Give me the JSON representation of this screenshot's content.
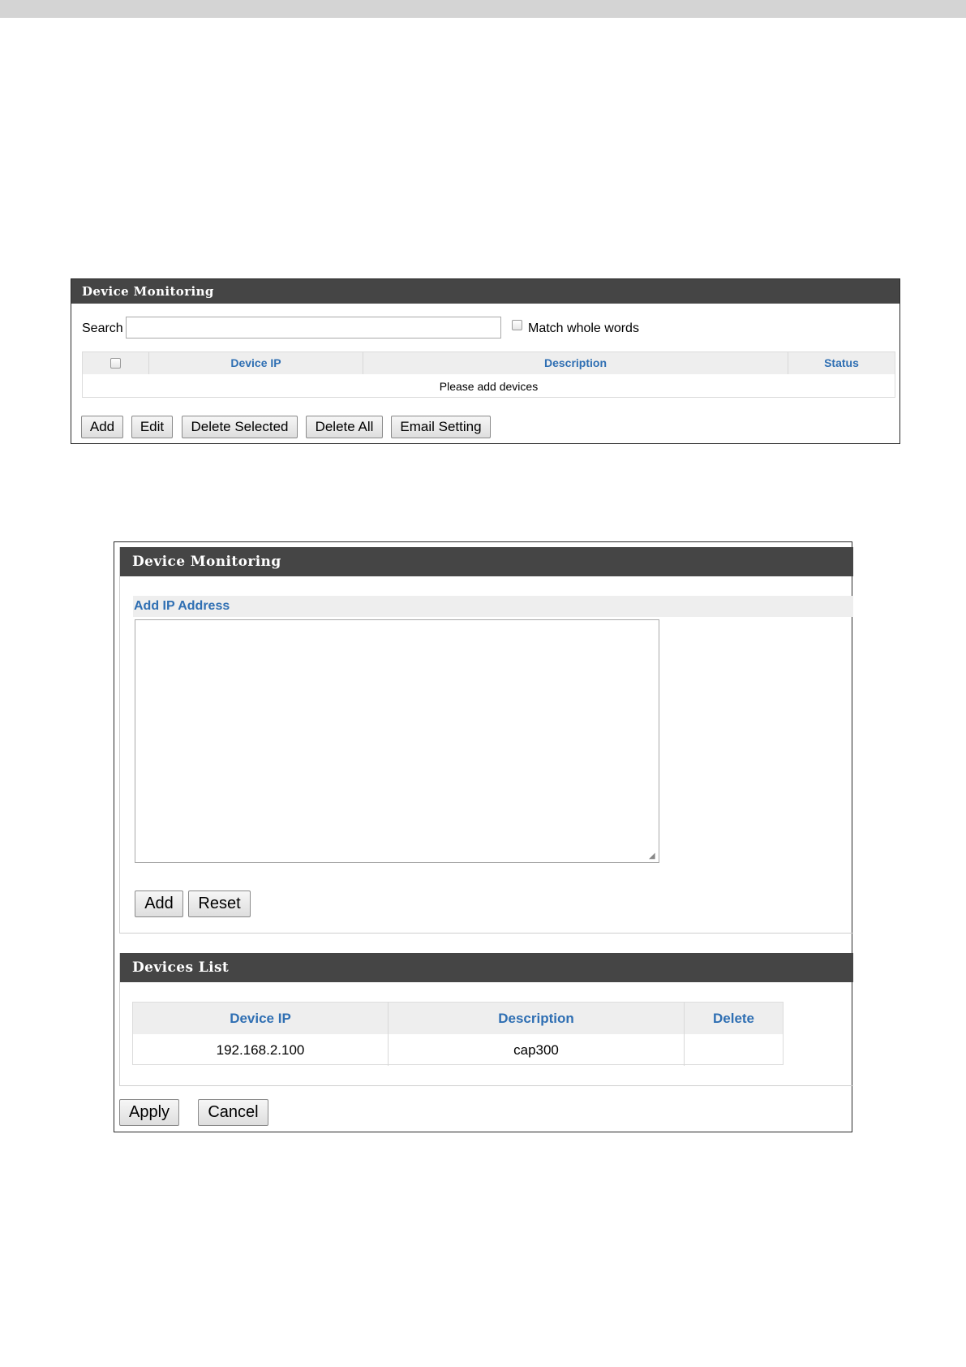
{
  "panel_monitoring": {
    "title": "Device Monitoring",
    "search_label": "Search",
    "search_value": "",
    "match_whole_words_label": "Match whole words",
    "match_whole_words_checked": false,
    "table": {
      "headers": [
        "Device IP",
        "Description",
        "Status"
      ],
      "empty_message": "Please add devices"
    },
    "buttons": {
      "add": "Add",
      "edit": "Edit",
      "delete_selected": "Delete Selected",
      "delete_all": "Delete All",
      "email_setting": "Email Setting"
    }
  },
  "panel_add": {
    "title": "Device Monitoring",
    "add_ip_title": "Add IP Address",
    "ip_textarea_value": "",
    "buttons": {
      "add": "Add",
      "reset": "Reset"
    },
    "devices_list": {
      "title": "Devices List",
      "headers": [
        "Device IP",
        "Description",
        "Delete"
      ],
      "rows": [
        {
          "device_ip": "192.168.2.100",
          "description": "cap300",
          "delete": ""
        }
      ]
    },
    "footer_buttons": {
      "apply": "Apply",
      "cancel": "Cancel"
    }
  },
  "colors": {
    "header_bg": "#454545",
    "header_text": "#ffffff",
    "table_header_text": "#2f6fb3",
    "table_header_bg": "#eeeeee",
    "top_band": "#d4d4d4"
  }
}
